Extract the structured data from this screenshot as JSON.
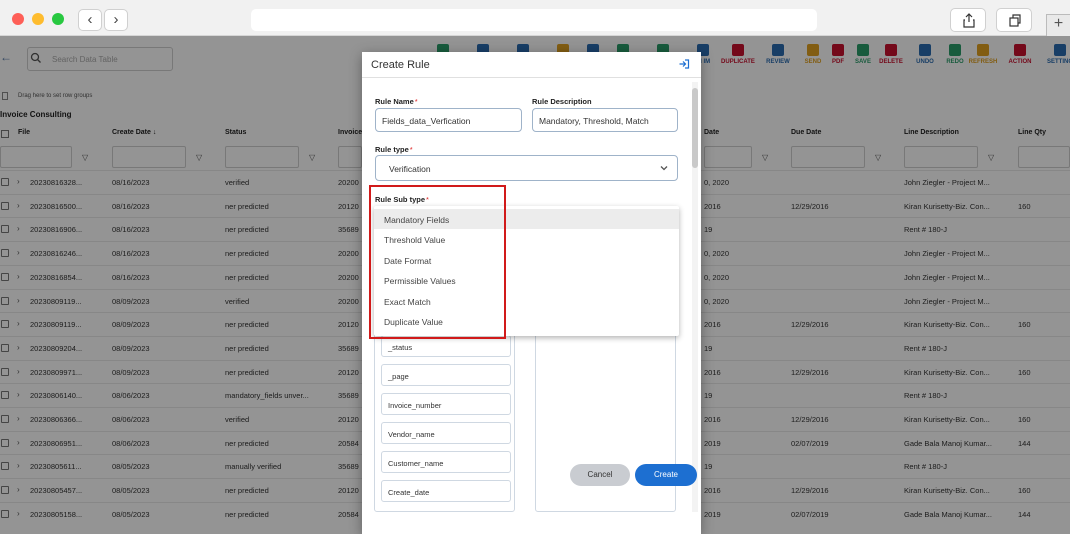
{
  "browser": {
    "back_glyph": "‹",
    "forward_glyph": "›",
    "new_tab_glyph": "+"
  },
  "app": {
    "search_placeholder": "Search Data Table",
    "toolbar": [
      {
        "label": "",
        "color": "#2a9d6a"
      },
      {
        "label": "",
        "color": "#2a6cb0"
      },
      {
        "label": "",
        "color": "#2a6cb0"
      },
      {
        "label": "",
        "color": "#e0a020"
      },
      {
        "label": "",
        "color": "#2a6cb0"
      },
      {
        "label": "",
        "color": "#2a9d6a"
      },
      {
        "label": "",
        "color": "#2a9d6a"
      },
      {
        "label": "IN IM",
        "color": "#2a6cb0"
      },
      {
        "label": "DUPLICATE",
        "color": "#c8102e"
      },
      {
        "label": "REVIEW",
        "color": "#2a6cb0"
      },
      {
        "label": "SEND",
        "color": "#e0a020"
      },
      {
        "label": "PDF",
        "color": "#c8102e"
      },
      {
        "label": "SAVE",
        "color": "#2a9d6a"
      },
      {
        "label": "DELETE",
        "color": "#c8102e"
      },
      {
        "label": "UNDO",
        "color": "#2a6cb0"
      },
      {
        "label": "REDO",
        "color": "#2a9d6a"
      },
      {
        "label": "REFRESH",
        "color": "#e0a020"
      },
      {
        "label": "ACTION",
        "color": "#c8102e"
      },
      {
        "label": "SETTING",
        "color": "#2a6cb0"
      }
    ],
    "group_hint": "Drag here to set row groups",
    "section_title": "Invoice Consulting",
    "columns": [
      "File",
      "Create Date ↓",
      "Status",
      "Invoice",
      "Date",
      "Due Date",
      "Line Description",
      "Line Qty"
    ],
    "rows": [
      {
        "file": "20230816328...",
        "create_date": "08/16/2023",
        "status": "verified",
        "invoice": "20200",
        "date": "0, 2020",
        "due": "",
        "desc": "John Ziegler - Project M...",
        "qty": ""
      },
      {
        "file": "20230816500...",
        "create_date": "08/16/2023",
        "status": "ner predicted",
        "invoice": "20120",
        "date": "2016",
        "due": "12/29/2016",
        "desc": "Kiran Kurisetty-Biz. Con...",
        "qty": "160"
      },
      {
        "file": "20230816906...",
        "create_date": "08/16/2023",
        "status": "ner predicted",
        "invoice": "35689",
        "date": "19",
        "due": "",
        "desc": "Rent # 180-J",
        "qty": ""
      },
      {
        "file": "20230816246...",
        "create_date": "08/16/2023",
        "status": "ner predicted",
        "invoice": "20200",
        "date": "0, 2020",
        "due": "",
        "desc": "John Ziegler - Project M...",
        "qty": ""
      },
      {
        "file": "20230816854...",
        "create_date": "08/16/2023",
        "status": "ner predicted",
        "invoice": "20200",
        "date": "0, 2020",
        "due": "",
        "desc": "John Ziegler - Project M...",
        "qty": ""
      },
      {
        "file": "20230809119...",
        "create_date": "08/09/2023",
        "status": "verified",
        "invoice": "20200",
        "date": "0, 2020",
        "due": "",
        "desc": "John Ziegler - Project M...",
        "qty": ""
      },
      {
        "file": "20230809119...",
        "create_date": "08/09/2023",
        "status": "ner predicted",
        "invoice": "20120",
        "date": "2016",
        "due": "12/29/2016",
        "desc": "Kiran Kurisetty-Biz. Con...",
        "qty": "160"
      },
      {
        "file": "20230809204...",
        "create_date": "08/09/2023",
        "status": "ner predicted",
        "invoice": "35689",
        "date": "19",
        "due": "",
        "desc": "Rent # 180-J",
        "qty": ""
      },
      {
        "file": "20230809971...",
        "create_date": "08/09/2023",
        "status": "ner predicted",
        "invoice": "20120",
        "date": "2016",
        "due": "12/29/2016",
        "desc": "Kiran Kurisetty-Biz. Con...",
        "qty": "160"
      },
      {
        "file": "20230806140...",
        "create_date": "08/06/2023",
        "status": "mandatory_fields unver...",
        "invoice": "35689",
        "date": "19",
        "due": "",
        "desc": "Rent # 180-J",
        "qty": ""
      },
      {
        "file": "20230806366...",
        "create_date": "08/06/2023",
        "status": "verified",
        "invoice": "20120",
        "date": "2016",
        "due": "12/29/2016",
        "desc": "Kiran Kurisetty-Biz. Con...",
        "qty": "160"
      },
      {
        "file": "20230806951...",
        "create_date": "08/06/2023",
        "status": "ner predicted",
        "invoice": "20584",
        "date": "2019",
        "due": "02/07/2019",
        "desc": "Gade Bala Manoj Kumar...",
        "qty": "144"
      },
      {
        "file": "20230805611...",
        "create_date": "08/05/2023",
        "status": "manually verified",
        "invoice": "35689",
        "date": "19",
        "due": "",
        "desc": "Rent # 180-J",
        "qty": ""
      },
      {
        "file": "20230805457...",
        "create_date": "08/05/2023",
        "status": "ner predicted",
        "invoice": "20120",
        "date": "2016",
        "due": "12/29/2016",
        "desc": "Kiran Kurisetty-Biz. Con...",
        "qty": "160"
      },
      {
        "file": "20230805158...",
        "create_date": "08/05/2023",
        "status": "ner predicted",
        "invoice": "20584",
        "date": "2019",
        "due": "02/07/2019",
        "desc": "Gade Bala Manoj Kumar...",
        "qty": "144"
      }
    ]
  },
  "modal": {
    "title": "Create Rule",
    "rule_name_label": "Rule Name",
    "rule_name_value": "Fields_data_Verfication",
    "rule_desc_label": "Rule Description",
    "rule_desc_value": "Mandatory, Threshold, Match",
    "rule_type_label": "Rule type",
    "rule_type_value": "Verification",
    "rule_subtype_label": "Rule Sub type",
    "required_mark": "*",
    "subtype_options": [
      "Mandatory Fields",
      "Threshold Value",
      "Date Format",
      "Permissible Values",
      "Exact Match",
      "Duplicate Value"
    ],
    "fields": [
      "_status",
      "_page",
      "Invoice_number",
      "Vendor_name",
      "Customer_name",
      "Create_date"
    ],
    "cancel_label": "Cancel",
    "create_label": "Create"
  }
}
